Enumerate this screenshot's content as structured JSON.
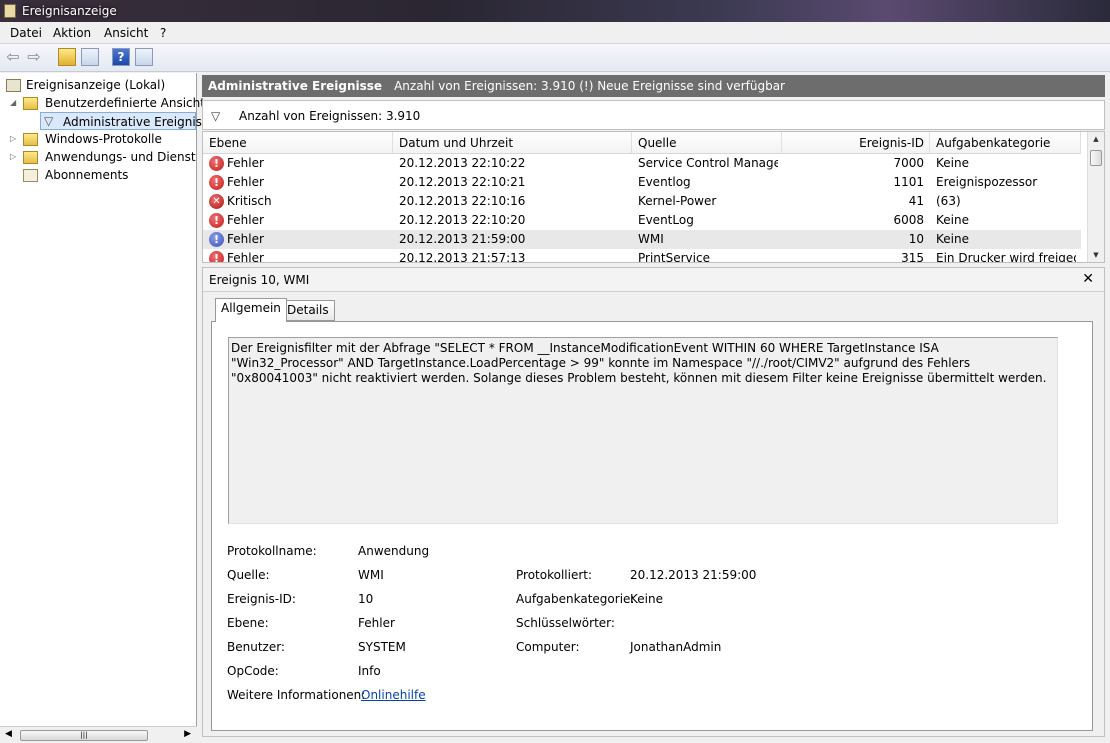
{
  "window": {
    "title": "Ereignisanzeige"
  },
  "menu": [
    "Datei",
    "Aktion",
    "Ansicht",
    "?"
  ],
  "tree": {
    "root": "Ereignisanzeige (Lokal)",
    "custom_views": "Benutzerdefinierte Ansichten",
    "admin_events": "Administrative Ereignisse",
    "windows_logs": "Windows-Protokolle",
    "app_logs": "Anwendungs- und Dienstpro",
    "subscriptions": "Abonnements"
  },
  "header": {
    "title": "Administrative Ereignisse",
    "info": "Anzahl von Ereignissen: 3.910 (!) Neue Ereignisse sind verfügbar"
  },
  "filter": {
    "text": "Anzahl von Ereignissen: 3.910"
  },
  "grid": {
    "columns": [
      "Ebene",
      "Datum und Uhrzeit",
      "Quelle",
      "Ereignis-ID",
      "Aufgabenkategorie"
    ],
    "rows": [
      {
        "level": "Fehler",
        "icon": "error-icon",
        "date": "20.12.2013 22:10:22",
        "source": "Service Control Manager",
        "id": "7000",
        "category": "Keine"
      },
      {
        "level": "Fehler",
        "icon": "error-icon",
        "date": "20.12.2013 22:10:21",
        "source": "Eventlog",
        "id": "1101",
        "category": "Ereignispozessor"
      },
      {
        "level": "Kritisch",
        "icon": "critical-icon",
        "date": "20.12.2013 22:10:16",
        "source": "Kernel-Power",
        "id": "41",
        "category": "(63)"
      },
      {
        "level": "Fehler",
        "icon": "error-icon",
        "date": "20.12.2013 22:10:20",
        "source": "EventLog",
        "id": "6008",
        "category": "Keine"
      },
      {
        "level": "Fehler",
        "icon": "error-icon",
        "date": "20.12.2013 21:59:00",
        "source": "WMI",
        "id": "10",
        "category": "Keine"
      },
      {
        "level": "Fehler",
        "icon": "error-icon",
        "date": "20.12.2013 21:57:13",
        "source": "PrintService",
        "id": "315",
        "category": "Ein Drucker wird freigeg..."
      }
    ]
  },
  "detail": {
    "title": "Ereignis 10, WMI",
    "tabs": [
      "Allgemein",
      "Details"
    ],
    "description": "Der Ereignisfilter mit der Abfrage \"SELECT * FROM __InstanceModificationEvent WITHIN 60 WHERE TargetInstance ISA \"Win32_Processor\" AND TargetInstance.LoadPercentage > 99\" konnte im Namespace \"//./root/CIMV2\" aufgrund des Fehlers \"0x80041003\" nicht reaktiviert werden. Solange dieses Problem besteht, können mit diesem Filter keine Ereignisse übermittelt werden.",
    "fields": {
      "protokollname_label": "Protokollname:",
      "protokollname": "Anwendung",
      "quelle_label": "Quelle:",
      "quelle": "WMI",
      "protokolliert_label": "Protokolliert:",
      "protokolliert": "20.12.2013 21:59:00",
      "id_label": "Ereignis-ID:",
      "id": "10",
      "kategorie_label": "Aufgabenkategorie:",
      "kategorie": "Keine",
      "ebene_label": "Ebene:",
      "ebene": "Fehler",
      "keywords_label": "Schlüsselwörter:",
      "keywords": "",
      "benutzer_label": "Benutzer:",
      "benutzer": "SYSTEM",
      "computer_label": "Computer:",
      "computer": "JonathanAdmin",
      "opcode_label": "OpCode:",
      "opcode": "Info",
      "info_label": "Weitere Informationen:",
      "info_link": "Onlinehilfe"
    }
  }
}
